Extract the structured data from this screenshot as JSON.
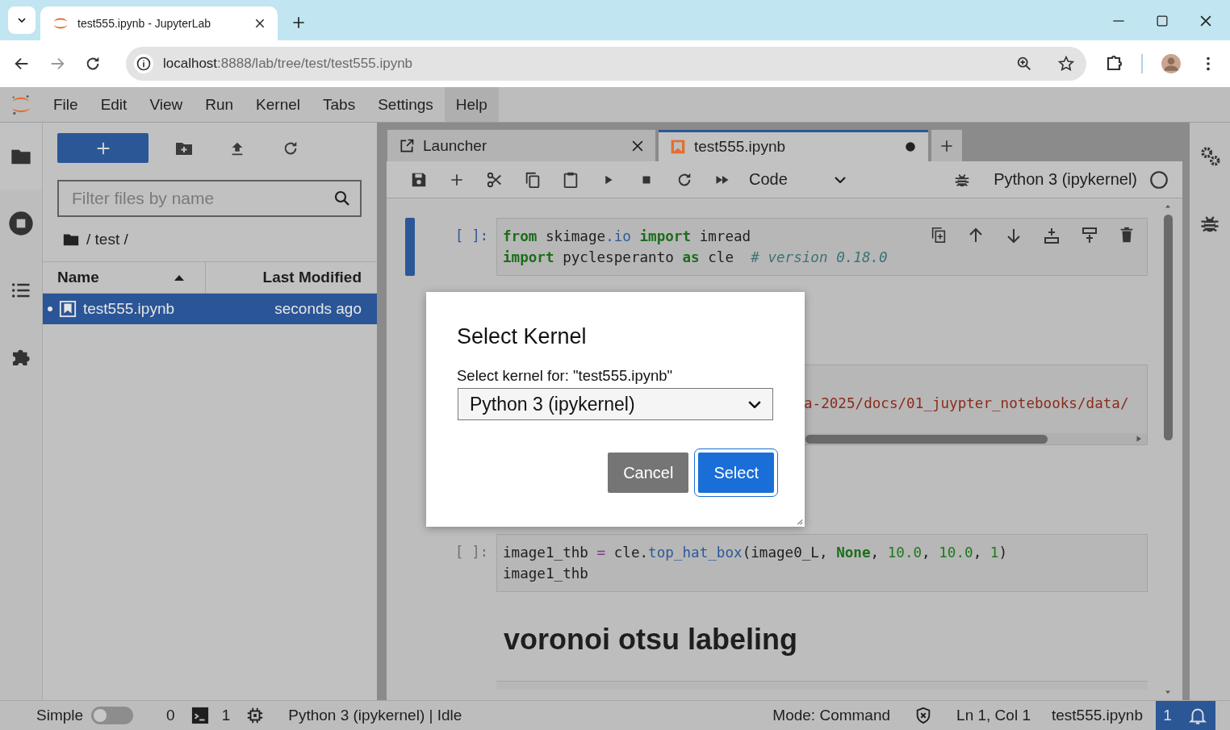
{
  "browser": {
    "tab_title": "test555.ipynb - JupyterLab",
    "url_host": "localhost",
    "url_path": ":8888/lab/tree/test/test555.ipynb"
  },
  "menu": [
    {
      "label": "File",
      "selected": false
    },
    {
      "label": "Edit",
      "selected": false
    },
    {
      "label": "View",
      "selected": false
    },
    {
      "label": "Run",
      "selected": false
    },
    {
      "label": "Kernel",
      "selected": false
    },
    {
      "label": "Tabs",
      "selected": false
    },
    {
      "label": "Settings",
      "selected": false
    },
    {
      "label": "Help",
      "selected": true
    }
  ],
  "file_browser": {
    "filter_placeholder": "Filter files by name",
    "breadcrumb": "/ test /",
    "columns": [
      {
        "label": "Name",
        "sorted": true
      },
      {
        "label": "Last Modified",
        "sorted": false
      }
    ],
    "files": [
      {
        "name": "test555.ipynb",
        "modified": "seconds ago",
        "selected": true
      }
    ]
  },
  "doc_tabs": [
    {
      "label": "Launcher",
      "kind": "launcher",
      "selected": false,
      "unsaved": false
    },
    {
      "label": "test555.ipynb",
      "kind": "notebook",
      "selected": true,
      "unsaved": true
    }
  ],
  "toolbar": {
    "cell_type": "Code",
    "kernel": "Python 3 (ipykernel)"
  },
  "cells": [
    {
      "kind": "code",
      "prompt": "[ ]:",
      "selected": true,
      "lines": [
        [
          {
            "text": "from",
            "kind": "kw"
          },
          {
            "text": " skimage",
            "kind": "name"
          },
          {
            "text": ".io",
            "kind": "attr"
          },
          {
            "text": " import",
            "kind": "kw"
          },
          {
            "text": " imread",
            "kind": "name"
          }
        ],
        [
          {
            "text": "import",
            "kind": "kw"
          },
          {
            "text": " pyclesperanto ",
            "kind": "name"
          },
          {
            "text": "as",
            "kind": "kw"
          },
          {
            "text": " cle  ",
            "kind": "name"
          },
          {
            "text": "# version 0.18.0",
            "kind": "comment"
          }
        ]
      ]
    },
    {
      "kind": "clipped",
      "lines": [
        [
          {
            "text": "a-2025/docs/01_juypter_notebooks/data/",
            "kind": "str"
          }
        ]
      ]
    },
    {
      "kind": "code",
      "prompt": "[ ]:",
      "selected": false,
      "lines": [
        [
          {
            "text": "image1_thb ",
            "kind": "name"
          },
          {
            "text": "=",
            "kind": "op"
          },
          {
            "text": " cle.",
            "kind": "name"
          },
          {
            "text": "top_hat_box",
            "kind": "attr"
          },
          {
            "text": "(image0_L, ",
            "kind": "name"
          },
          {
            "text": "None",
            "kind": "kw"
          },
          {
            "text": ", ",
            "kind": "name"
          },
          {
            "text": "10.0",
            "kind": "num"
          },
          {
            "text": ", ",
            "kind": "name"
          },
          {
            "text": "10.0",
            "kind": "num"
          },
          {
            "text": ", ",
            "kind": "name"
          },
          {
            "text": "1",
            "kind": "num"
          },
          {
            "text": ")",
            "kind": "name"
          }
        ],
        [
          {
            "text": "image1_thb",
            "kind": "name"
          }
        ]
      ]
    },
    {
      "kind": "heading",
      "text": "voronoi otsu labeling"
    }
  ],
  "dialog": {
    "title": "Select Kernel",
    "label": "Select kernel for: \"test555.ipynb\"",
    "value": "Python 3 (ipykernel)",
    "buttons": [
      {
        "label": "Cancel",
        "kind": "cancel"
      },
      {
        "label": "Select",
        "kind": "accept"
      }
    ]
  },
  "status_bar": {
    "mode_label": "Simple",
    "simple_on": false,
    "terminals": "0",
    "kernels": "1",
    "kernel_status": "Python 3 (ipykernel) | Idle",
    "mode": "Mode: Command",
    "position": "Ln 1, Col 1",
    "file": "test555.ipynb",
    "notifications": "1"
  }
}
